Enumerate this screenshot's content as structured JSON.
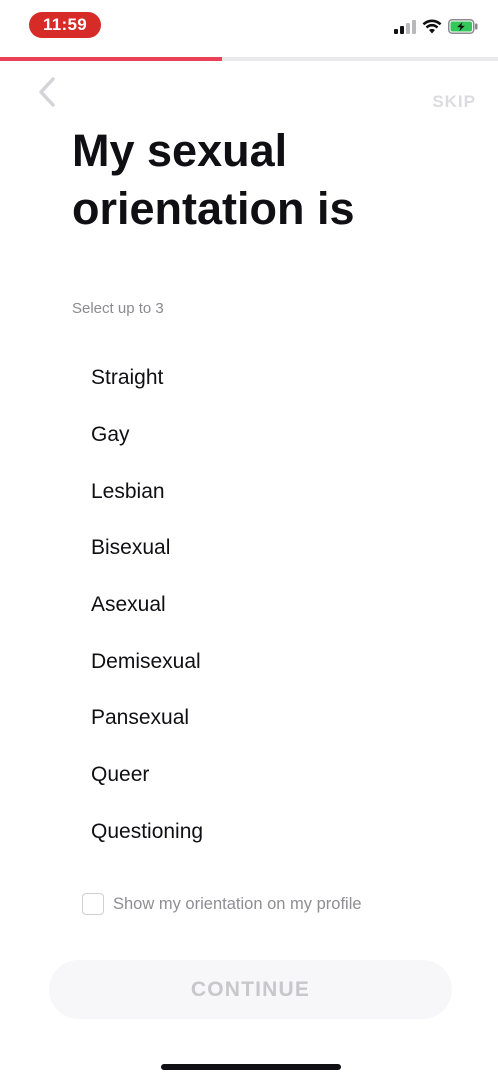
{
  "status_bar": {
    "time": "11:59",
    "icons": [
      "cellular-signal-icon",
      "wifi-icon",
      "battery-charging-icon"
    ],
    "time_pill_color": "#d62b26"
  },
  "progress": {
    "value_percent": 44.5,
    "fill_color": "#e94057"
  },
  "header": {
    "back_icon": "chevron-left-icon",
    "skip_label": "SKIP"
  },
  "title": "My sexual orientation is",
  "hint": "Select up to 3",
  "options": [
    {
      "label": "Straight"
    },
    {
      "label": "Gay"
    },
    {
      "label": "Lesbian"
    },
    {
      "label": "Bisexual"
    },
    {
      "label": "Asexual"
    },
    {
      "label": "Demisexual"
    },
    {
      "label": "Pansexual"
    },
    {
      "label": "Queer"
    },
    {
      "label": "Questioning"
    }
  ],
  "show_on_profile": {
    "label": "Show my orientation on my profile",
    "checked": false
  },
  "continue_label": "CONTINUE"
}
